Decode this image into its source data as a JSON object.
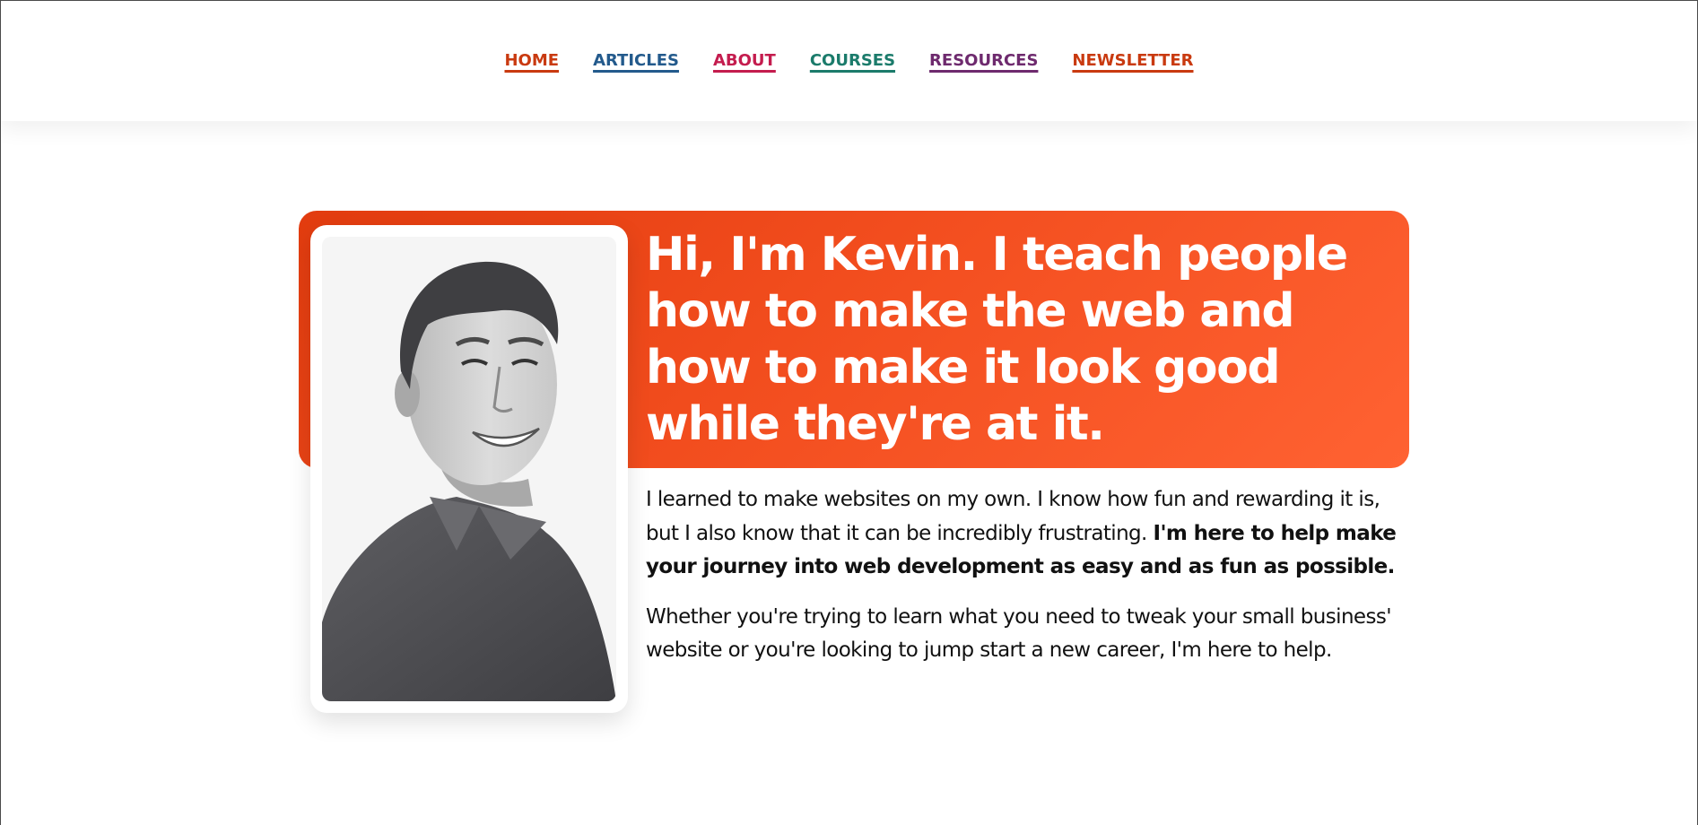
{
  "nav": {
    "items": [
      {
        "label": "HOME",
        "color": "#c93a10"
      },
      {
        "label": "ARTICLES",
        "color": "#235a8c"
      },
      {
        "label": "ABOUT",
        "color": "#c41c4e"
      },
      {
        "label": "COURSES",
        "color": "#1b7b6b"
      },
      {
        "label": "RESOURCES",
        "color": "#6e2a6e"
      },
      {
        "label": "NEWSLETTER",
        "color": "#c93a10"
      }
    ]
  },
  "hero": {
    "title": "Hi, I'm Kevin. I teach people how to make the web and how to make it look good while they're at it.",
    "banner_color": "#f24d1e",
    "portrait_icon": "portrait-photo",
    "intro_plain": "I learned to make websites on my own. I know how fun and rewarding it is, but I also know that it can be incredibly frustrating.",
    "intro_bold": "I'm here to help make your journey into web development as easy and as fun as possible.",
    "paragraph_two": "Whether you're trying to learn what you need to tweak your small business' website or you're looking to jump start a new career, I'm here to help."
  }
}
